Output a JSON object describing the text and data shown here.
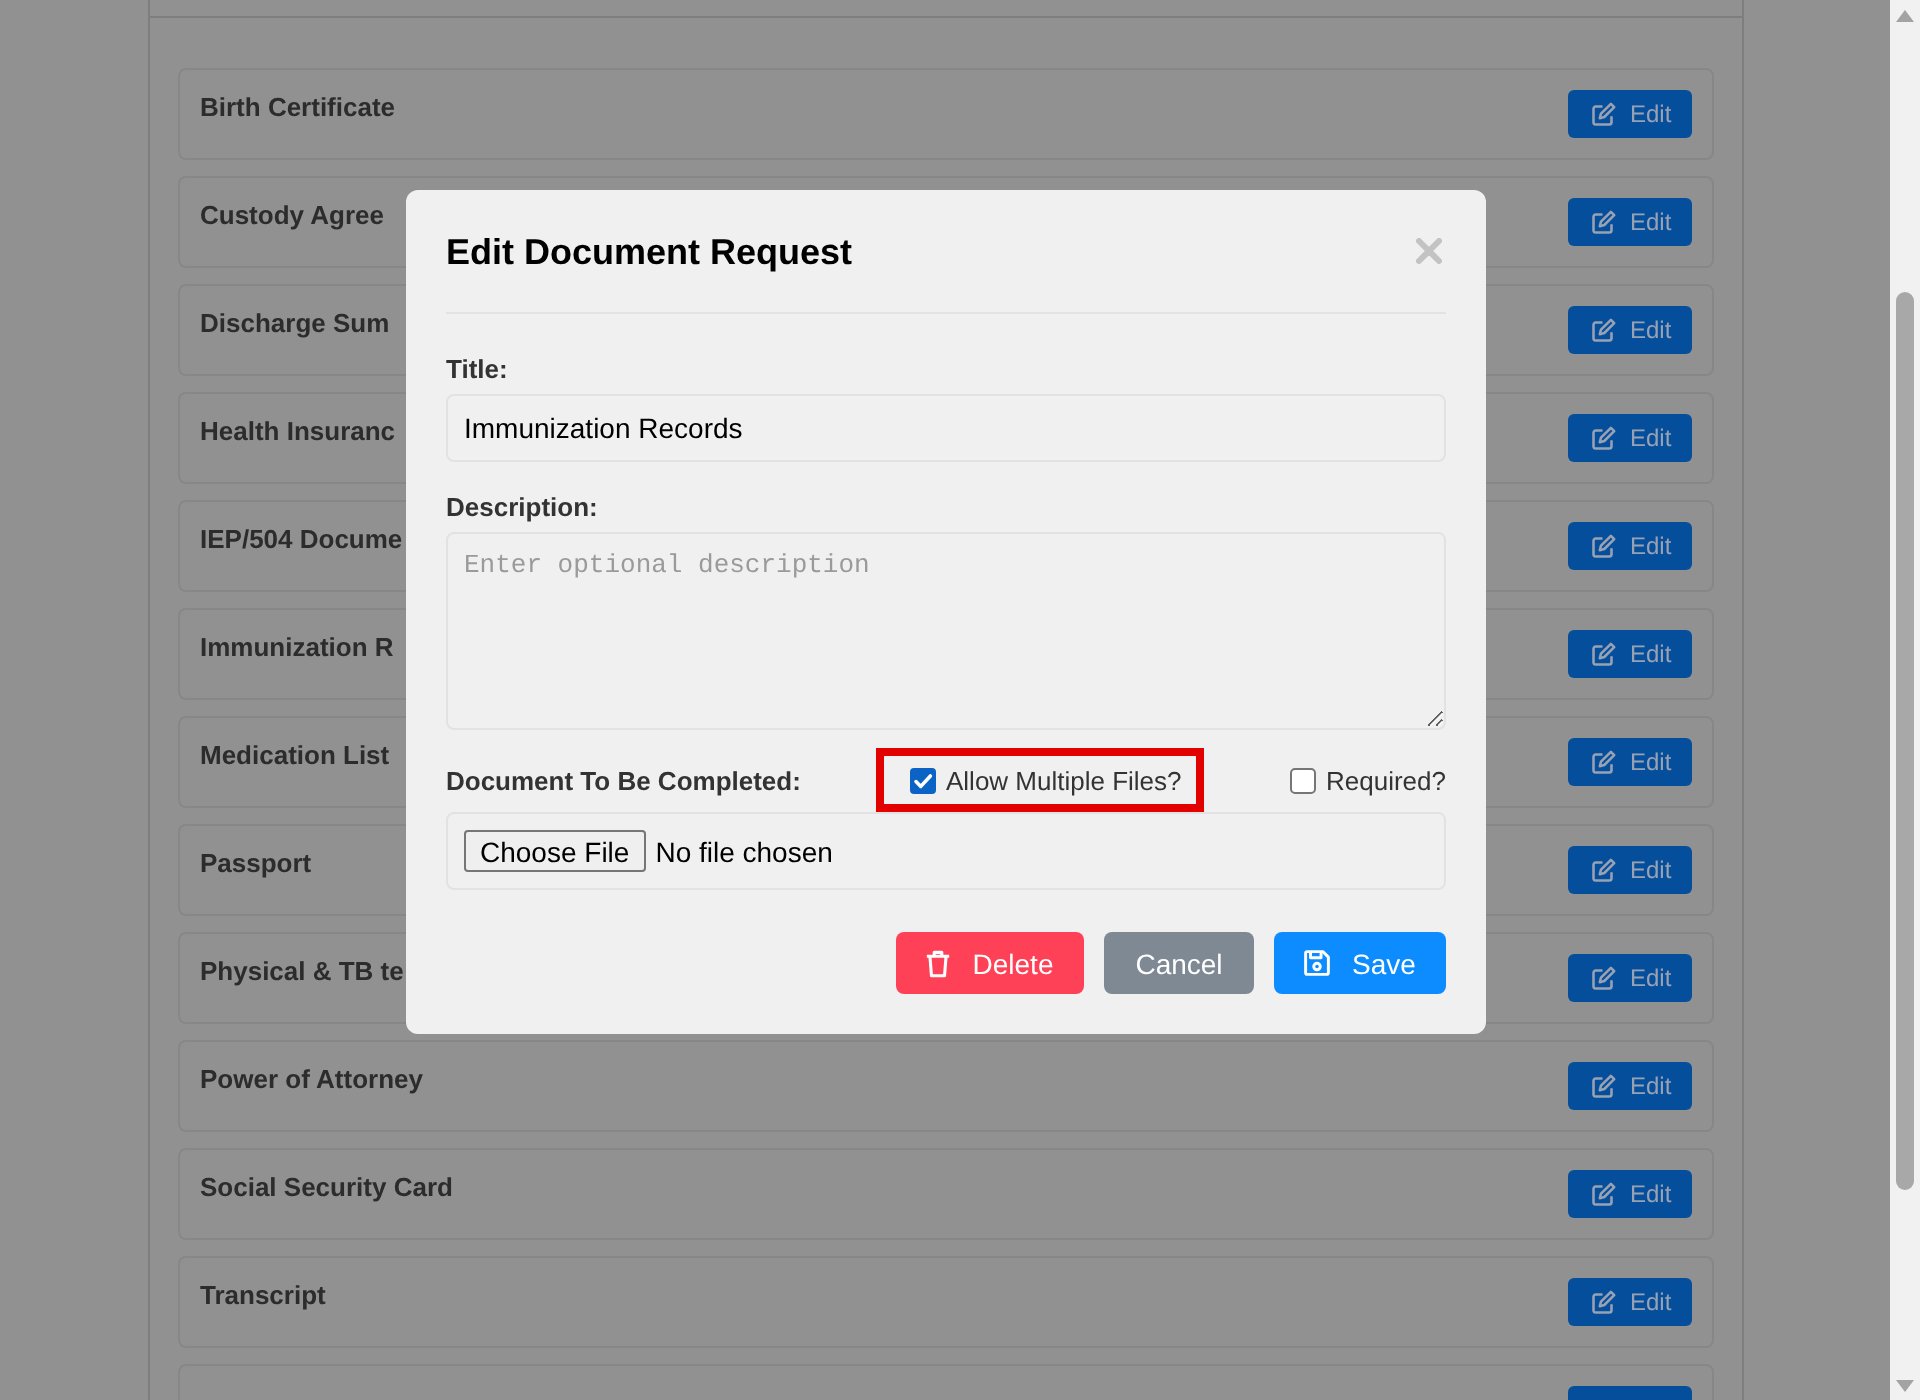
{
  "page": {
    "rows": [
      {
        "title": "Birth Certificate",
        "action": "Edit"
      },
      {
        "title": "Custody Agree",
        "action": "Edit"
      },
      {
        "title": "Discharge Sum",
        "action": "Edit"
      },
      {
        "title": "Health Insuranc",
        "action": "Edit"
      },
      {
        "title": "IEP/504 Docume",
        "action": "Edit"
      },
      {
        "title": "Immunization R",
        "action": "Edit"
      },
      {
        "title": "Medication List",
        "action": "Edit"
      },
      {
        "title": "Passport",
        "action": "Edit"
      },
      {
        "title": "Physical & TB te",
        "action": "Edit"
      },
      {
        "title": "Power of Attorney",
        "action": "Edit"
      },
      {
        "title": "Social Security Card",
        "action": "Edit"
      },
      {
        "title": "Transcript",
        "action": "Edit"
      }
    ],
    "partial_row_below": true
  },
  "modal": {
    "title": "Edit Document Request",
    "fields": [
      {
        "kind": "text",
        "label": "Title:",
        "value": "Immunization Records"
      },
      {
        "kind": "textarea",
        "label": "Description:",
        "placeholder": "Enter optional description"
      }
    ],
    "document": {
      "label": "Document To Be Completed:",
      "options": [
        {
          "label": "Allow Multiple Files?",
          "checked": true,
          "highlighted": true
        },
        {
          "label": "Required?",
          "checked": false,
          "highlighted": false
        }
      ],
      "file_button": "Choose File",
      "file_status": "No file chosen"
    },
    "buttons": [
      {
        "kind": "danger",
        "label": "Delete"
      },
      {
        "kind": "secondary",
        "label": "Cancel"
      },
      {
        "kind": "primary",
        "label": "Save"
      }
    ]
  }
}
